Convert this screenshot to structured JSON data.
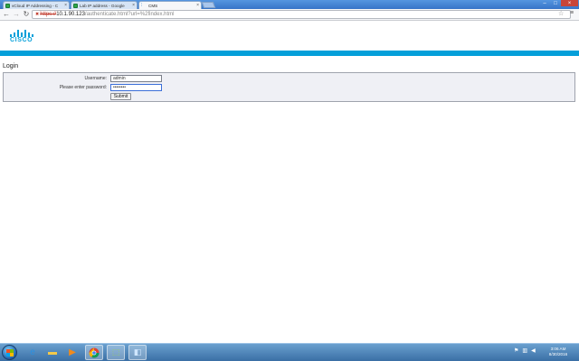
{
  "browser": {
    "tabs": [
      {
        "title": "vCloud IP Addressing - C",
        "icon": "green-page-icon",
        "active": false
      },
      {
        "title": "Lab IP address - Google",
        "icon": "green-page-icon",
        "active": false
      },
      {
        "title": "CMS",
        "icon": "cisco-icon",
        "active": true
      }
    ],
    "url": {
      "protocol": "https://",
      "host": "10.1.90.123",
      "path": "/authenticate.html?url=%2findex.html"
    }
  },
  "page": {
    "logo_text": "CISCO",
    "login_heading": "Login",
    "form": {
      "username_label": "Username:",
      "username_value": "admin",
      "password_label": "Please enter password:",
      "password_value": "••••••••",
      "submit_label": "Submit"
    }
  },
  "taskbar": {
    "apps": [
      "windows-explorer-icon",
      "ie-icon",
      "folder-icon",
      "media-player-icon",
      "chrome-icon",
      "vsphere-icon",
      "app-icon"
    ],
    "clock": {
      "time": "3:06 AM",
      "date": "8/30/2016"
    }
  },
  "colors": {
    "cisco_blue": "#049fd9",
    "panel_bg": "#eff0f5",
    "tab_strip": "#3d82d6"
  }
}
